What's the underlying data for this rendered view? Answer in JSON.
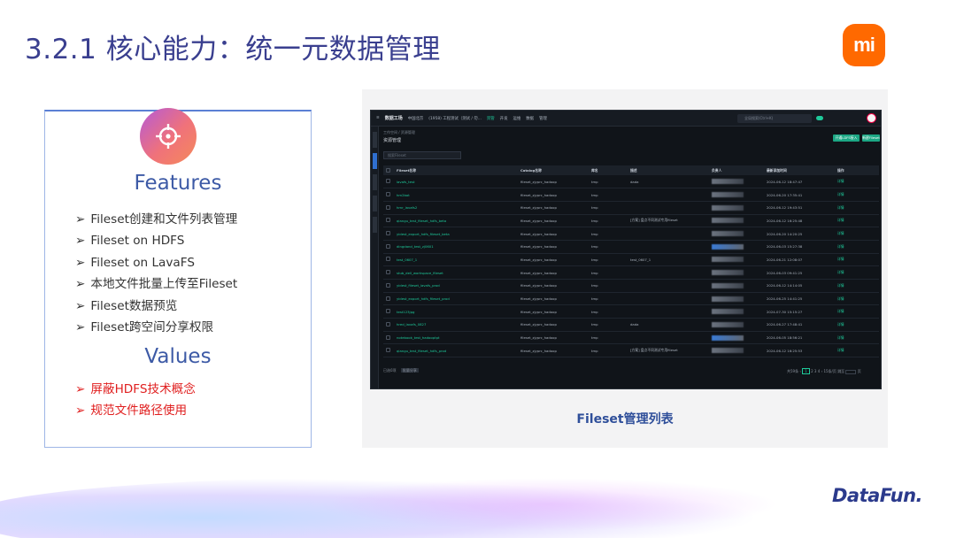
{
  "slide": {
    "title": "3.2.1 核心能力：统一元数据管理",
    "logo_text": "mi",
    "brand_text": "DataFun."
  },
  "card": {
    "icon": "target-crosshair-icon",
    "features_heading": "Features",
    "features": [
      "Fileset创建和文件列表管理",
      "Fileset on HDFS",
      "Fileset on LavaFS",
      "本地文件批量上传至Fileset",
      "Fileset数据预览",
      "Fileset跨空间分享权限"
    ],
    "values_heading": "Values",
    "values": [
      "屏蔽HDFS技术概念",
      "规范文件路径使用"
    ],
    "arrow": "➢"
  },
  "panel": {
    "caption": "Fileset管理列表"
  },
  "app": {
    "brand": "数据工场",
    "region": "中国北京",
    "workspace": "(1958) 工程测试（测试 / 勿...",
    "nav": [
      "资管",
      "开发",
      "运维",
      "数据",
      "管理"
    ],
    "nav_active": "资管",
    "search_placeholder": "全局搜索(Ctrl+K)",
    "breadcrumb": "工作空间 / 资源管理",
    "page_title": "资源管理",
    "btn_primary": "开通LDFS接入",
    "btn_secondary": "新建Fileset",
    "filter_placeholder": "搜索Fileset",
    "columns": [
      "Fileset名称",
      "Catalog名称",
      "库名",
      "描述",
      "负责人",
      "最新添加时间",
      "操作"
    ],
    "rows": [
      {
        "name": "lavafs_test",
        "catalog": "fileset_zjyprc_hadoop",
        "db": "tmp",
        "desc": "dada",
        "time": "2024-06-12 18:47:47",
        "op": "详情"
      },
      {
        "name": "hm2bot",
        "catalog": "fileset_zjyprc_hadoop",
        "db": "tmp",
        "desc": "",
        "time": "2024-06-20 17:35:41",
        "op": "详情"
      },
      {
        "name": "hmr_lavafs2",
        "catalog": "fileset_zjyprc_hadoop",
        "db": "tmp",
        "desc": "",
        "time": "2024-06-12 19:43:51",
        "op": "详情"
      },
      {
        "name": "qiangu_test_fileset_hdfs_beta",
        "catalog": "fileset_zjyprc_hadoop",
        "db": "tmp",
        "desc": "[方案] 盘点不同测试专用fileset",
        "time": "2024-06-12 16:25:48",
        "op": "详情"
      },
      {
        "name": "yidest_export_hdfs_fileset_beta",
        "catalog": "fileset_zjyprc_hadoop",
        "db": "tmp",
        "desc": "",
        "time": "2024-06-20 14:20:25",
        "op": "详情"
      },
      {
        "name": "dingdand_test_zj0601",
        "catalog": "fileset_zjyprc_hadoop",
        "db": "tmp",
        "desc": "",
        "time": "2024-06-03 15:27:38",
        "op": "详情"
      },
      {
        "name": "test_0607_1",
        "catalog": "fileset_zjyprc_hadoop",
        "db": "tmp",
        "desc": "test_0607_1",
        "time": "2024-06-21 12:08:07",
        "op": "详情"
      },
      {
        "name": "stub_dell_workspace_fileset",
        "catalog": "fileset_zjyprc_hadoop",
        "db": "tmp",
        "desc": "",
        "time": "2024-06-03 09:41:25",
        "op": "详情"
      },
      {
        "name": "yidest_fileset_lavafs_prod",
        "catalog": "fileset_zjyprc_hadoop",
        "db": "tmp",
        "desc": "",
        "time": "2024-06-12 14:14:05",
        "op": "详情"
      },
      {
        "name": "yidest_export_hdfs_fileset_prod",
        "catalog": "fileset_zjyprc_hadoop",
        "db": "tmp",
        "desc": "",
        "time": "2024-06-25 14:41:25",
        "op": "详情"
      },
      {
        "name": "test123jpg",
        "catalog": "fileset_zjyprc_hadoop",
        "db": "tmp",
        "desc": "",
        "time": "2024-07-30 15:15:27",
        "op": "详情"
      },
      {
        "name": "hred_lavafs_0827",
        "catalog": "fileset_zjyprc_hadoop",
        "db": "tmp",
        "desc": "dada",
        "time": "2024-06-27 17:48:41",
        "op": "详情"
      },
      {
        "name": "notebook_test_hadooptpt",
        "catalog": "fileset_zjyprc_hadoop",
        "db": "tmp",
        "desc": "",
        "time": "2024-06-05 18:56:21",
        "op": "详情"
      },
      {
        "name": "qiangu_test_fileset_hdfs_prod",
        "catalog": "fileset_zjyprc_hadoop",
        "db": "tmp",
        "desc": "[方案] 盘点不同测试专用fileset",
        "time": "2024-06-12 16:25:53",
        "op": "详情"
      }
    ],
    "pager_left": "已选0项",
    "pager_left_btn": "批量分享",
    "pager_total": "共59条",
    "pager_current": "1",
    "pager_pages": [
      "2",
      "3",
      "4"
    ],
    "pager_size": "15条/页",
    "pager_goto": "跳至",
    "pager_unit": "页"
  }
}
